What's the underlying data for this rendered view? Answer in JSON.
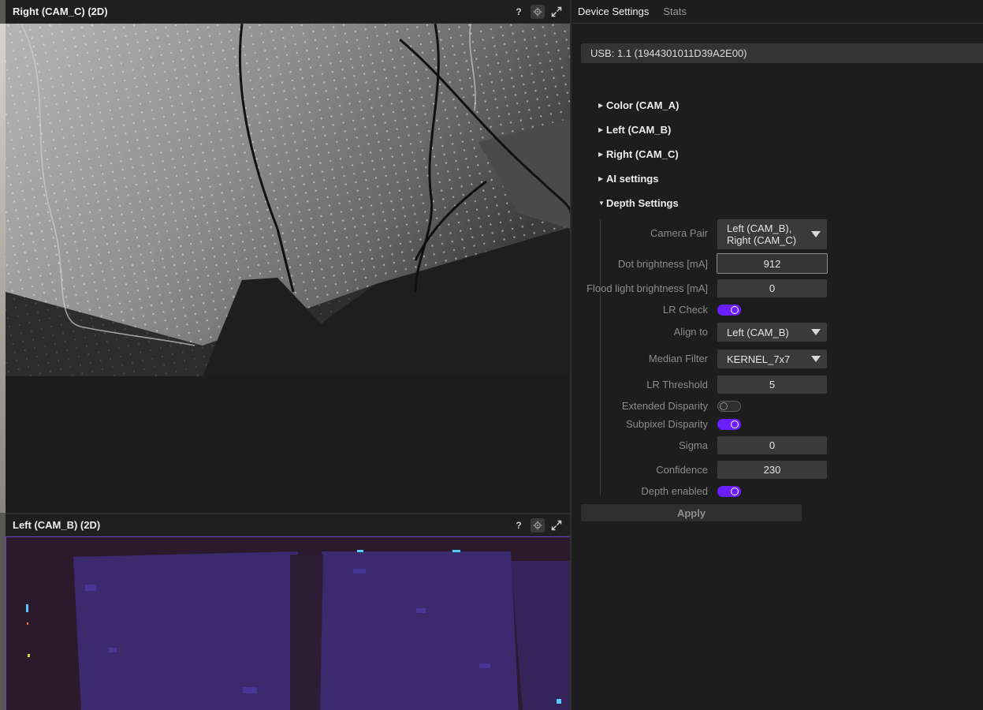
{
  "viewports": {
    "top": {
      "title": "Right (CAM_C) (2D)",
      "help": "?"
    },
    "bottom": {
      "title": "Left (CAM_B) (2D)",
      "help": "?"
    }
  },
  "tabs": [
    {
      "label": "Device Settings",
      "active": true
    },
    {
      "label": "Stats",
      "active": false
    }
  ],
  "device": {
    "label": "USB: 1.1 (1944301011D39A2E00)"
  },
  "sections": [
    {
      "label": "Color (CAM_A)",
      "expanded": false
    },
    {
      "label": "Left (CAM_B)",
      "expanded": false
    },
    {
      "label": "Right (CAM_C)",
      "expanded": false
    },
    {
      "label": "AI settings",
      "expanded": false
    },
    {
      "label": "Depth Settings",
      "expanded": true
    }
  ],
  "depth": {
    "camera_pair": {
      "label": "Camera Pair",
      "value": "Left (CAM_B), Right (CAM_C)"
    },
    "dot_brightness": {
      "label": "Dot brightness [mA]",
      "value": "912"
    },
    "flood_brightness": {
      "label": "Flood light brightness [mA]",
      "value": "0"
    },
    "lr_check": {
      "label": "LR Check",
      "on": true
    },
    "align_to": {
      "label": "Align to",
      "value": "Left (CAM_B)"
    },
    "median_filter": {
      "label": "Median Filter",
      "value": "KERNEL_7x7"
    },
    "lr_threshold": {
      "label": "LR Threshold",
      "value": "5"
    },
    "extended_disparity": {
      "label": "Extended Disparity",
      "on": false
    },
    "subpixel_disparity": {
      "label": "Subpixel Disparity",
      "on": true
    },
    "sigma": {
      "label": "Sigma",
      "value": "0"
    },
    "confidence": {
      "label": "Confidence",
      "value": "230"
    },
    "depth_enabled": {
      "label": "Depth enabled",
      "on": true
    }
  },
  "apply": {
    "label": "Apply"
  },
  "colors": {
    "accent": "#6b1fff",
    "panel_bg": "#1d1d1d",
    "field_bg": "#3a3a3a",
    "depth_tint": "#3b2a6e"
  },
  "icons": [
    "gear-icon",
    "maximize-icon",
    "triangle-right-icon",
    "triangle-down-icon",
    "chevron-down-icon"
  ]
}
